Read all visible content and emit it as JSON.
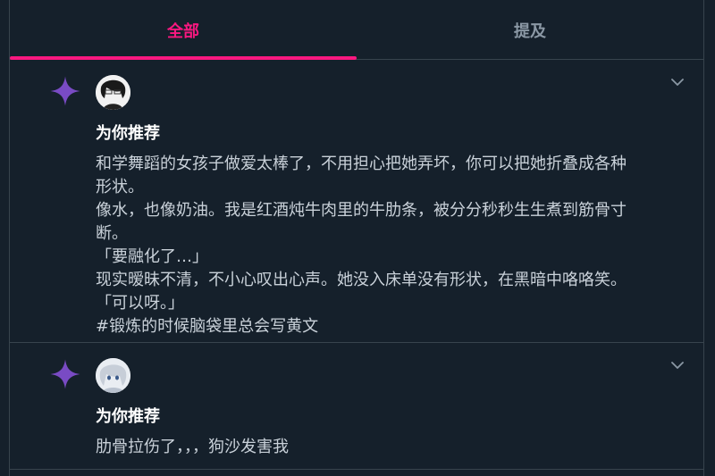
{
  "tabs": [
    {
      "label": "全部",
      "active": true
    },
    {
      "label": "提及",
      "active": false
    }
  ],
  "notifications": [
    {
      "label": "为你推荐",
      "lines": [
        "和学舞蹈的女孩子做爱太棒了，不用担心把她弄坏，你可以把她折叠成各种",
        "形状。",
        "像水，也像奶油。我是红酒炖牛肉里的牛肋条，被分分秒秒生生煮到筋骨寸",
        "断。",
        "「要融化了…」",
        "现实暧昧不清，不小心叹出心声。她没入床单没有形状，在黑暗中咯咯笑。",
        "「可以呀。」",
        "#锻炼的时候脑袋里总会写黄文"
      ]
    },
    {
      "label": "为你推荐",
      "lines": [
        "肋骨拉伤了，，，狗沙发害我"
      ]
    }
  ],
  "colors": {
    "background": "#15202b",
    "accent": "#f91880",
    "sparkle": "#794bc4",
    "border": "#38444d"
  },
  "icons": [
    "sparkle-icon",
    "chevron-down-icon"
  ]
}
